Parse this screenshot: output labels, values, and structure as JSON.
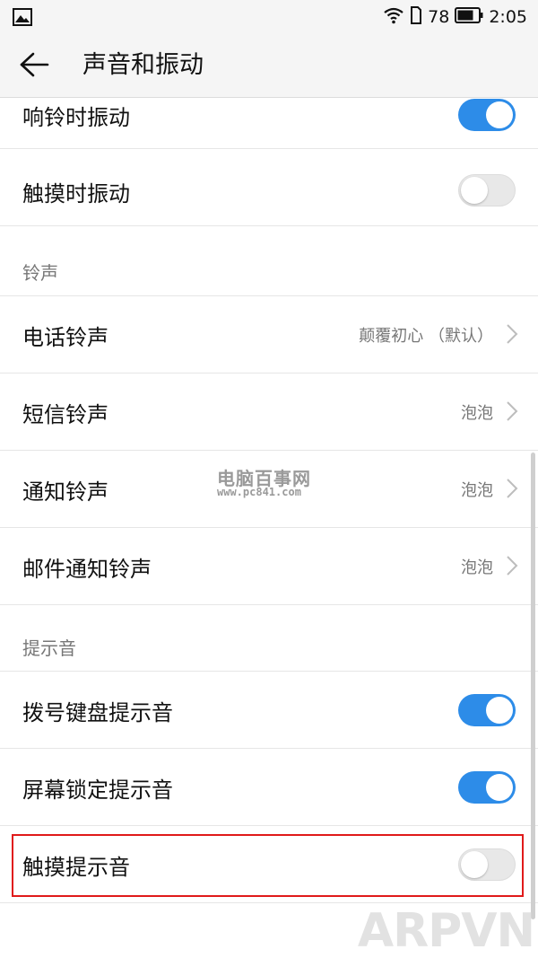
{
  "status_bar": {
    "battery_level": "78",
    "time": "2:05",
    "icons": [
      "gallery-icon",
      "wifi-icon",
      "sim-icon",
      "battery-icon"
    ]
  },
  "header": {
    "title": "声音和振动",
    "back_icon": "back-arrow-icon"
  },
  "vibration": {
    "ring_vibrate": {
      "label": "响铃时振动",
      "on": true
    },
    "touch_vibrate": {
      "label": "触摸时振动",
      "on": false
    }
  },
  "ringtones": {
    "section_title": "铃声",
    "items": [
      {
        "label": "电话铃声",
        "value": "颠覆初心 （默认）"
      },
      {
        "label": "短信铃声",
        "value": "泡泡"
      },
      {
        "label": "通知铃声",
        "value": "泡泡"
      },
      {
        "label": "邮件通知铃声",
        "value": "泡泡"
      }
    ]
  },
  "sounds": {
    "section_title": "提示音",
    "items": [
      {
        "label": "拨号键盘提示音",
        "on": true
      },
      {
        "label": "屏幕锁定提示音",
        "on": true
      },
      {
        "label": "触摸提示音",
        "on": false
      }
    ]
  },
  "watermark": {
    "site_name": "电脑百事网",
    "site_url": "www.pc841.com",
    "corner_text": "ARPVN"
  },
  "colors": {
    "accent": "#2d8ce8",
    "highlight": "#e01a1a",
    "toggle_off": "#e8e8e8"
  }
}
